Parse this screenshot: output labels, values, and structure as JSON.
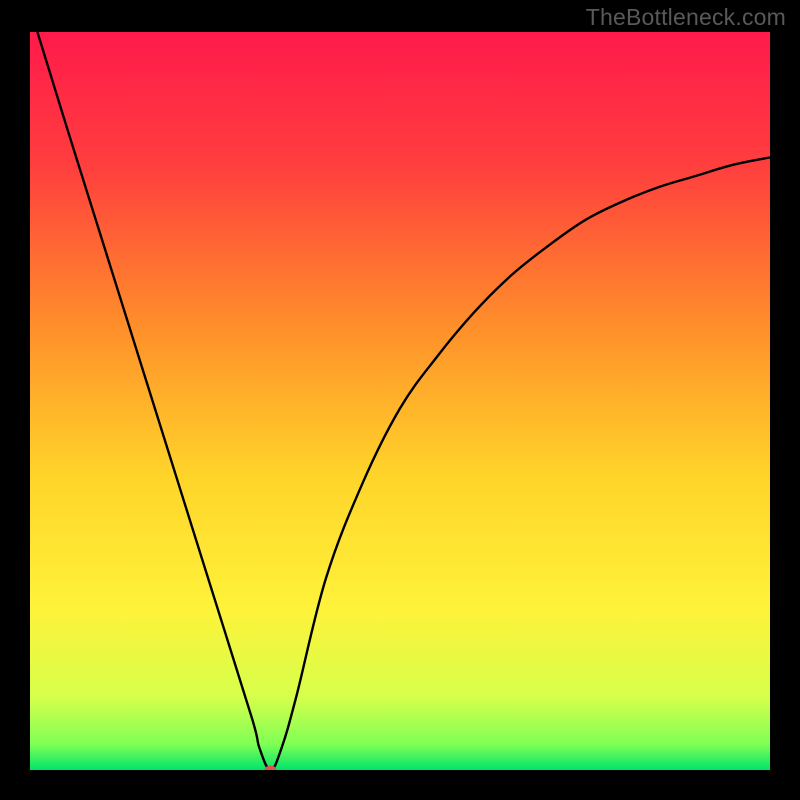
{
  "watermark": "TheBottleneck.com",
  "chart_data": {
    "type": "line",
    "title": "",
    "xlabel": "",
    "ylabel": "",
    "xlim": [
      0,
      100
    ],
    "ylim": [
      0,
      100
    ],
    "grid": false,
    "legend": false,
    "background_gradient": {
      "type": "vertical",
      "stops": [
        {
          "offset": 0.0,
          "color": "#ff1a4b"
        },
        {
          "offset": 0.18,
          "color": "#ff3e3e"
        },
        {
          "offset": 0.4,
          "color": "#ff8f2a"
        },
        {
          "offset": 0.6,
          "color": "#ffd42a"
        },
        {
          "offset": 0.78,
          "color": "#fff23a"
        },
        {
          "offset": 0.9,
          "color": "#d7ff4a"
        },
        {
          "offset": 0.965,
          "color": "#7fff55"
        },
        {
          "offset": 1.0,
          "color": "#00e56b"
        }
      ]
    },
    "series": [
      {
        "name": "bottleneck-curve",
        "color": "#000000",
        "x": [
          1,
          5,
          10,
          15,
          20,
          25,
          30,
          31,
          32.5,
          34,
          36,
          40,
          45,
          50,
          55,
          60,
          65,
          70,
          75,
          80,
          85,
          90,
          95,
          100
        ],
        "y": [
          100,
          87,
          71,
          55,
          39,
          23,
          7,
          3,
          0,
          3,
          10,
          26,
          39,
          49,
          56,
          62,
          67,
          71,
          74.5,
          77,
          79,
          80.5,
          82,
          83
        ]
      }
    ],
    "marker": {
      "name": "optimal-point",
      "x": 32.5,
      "y": 0,
      "color": "#d45a4a",
      "rx": 6,
      "ry": 4.5
    }
  }
}
